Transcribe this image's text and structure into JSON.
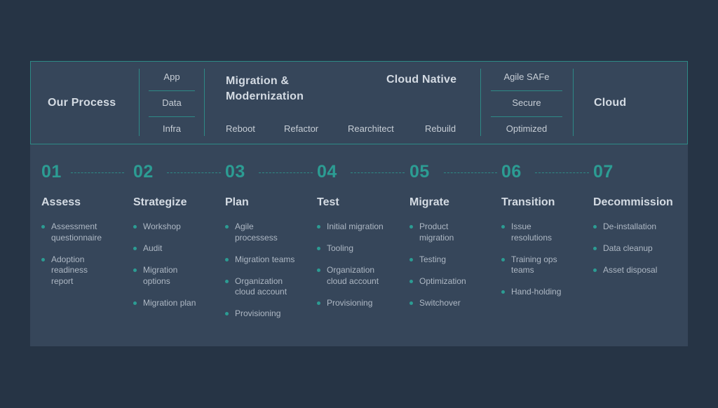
{
  "header": {
    "our_process": "Our Process",
    "layers": [
      "App",
      "Data",
      "Infra"
    ],
    "migration_title": "Migration &",
    "migration_title2": "Modernization",
    "cloud_native": "Cloud Native",
    "approaches": [
      "Reboot",
      "Refactor",
      "Rearchitect",
      "Rebuild"
    ],
    "qualities": [
      "Agile SAFe",
      "Secure",
      "Optimized"
    ],
    "cloud": "Cloud"
  },
  "steps": [
    {
      "num": "01",
      "title": "Assess",
      "items": [
        "Assessment questionnaire",
        "Adoption readiness report"
      ]
    },
    {
      "num": "02",
      "title": "Strategize",
      "items": [
        "Workshop",
        "Audit",
        "Migration options",
        "Migration plan"
      ]
    },
    {
      "num": "03",
      "title": "Plan",
      "items": [
        "Agile processess",
        "Migration teams",
        "Organization cloud account",
        "Provisioning"
      ]
    },
    {
      "num": "04",
      "title": "Test",
      "items": [
        "Initial migration",
        "Tooling",
        "Organization cloud account",
        "Provisioning"
      ]
    },
    {
      "num": "05",
      "title": "Migrate",
      "items": [
        "Product migration",
        "Testing",
        "Optimization",
        "Switchover"
      ]
    },
    {
      "num": "06",
      "title": "Transition",
      "items": [
        "Issue resolutions",
        "Training ops teams",
        "Hand-holding"
      ]
    },
    {
      "num": "07",
      "title": "Decommission",
      "items": [
        "De-installation",
        "Data cleanup",
        "Asset disposal"
      ]
    }
  ]
}
